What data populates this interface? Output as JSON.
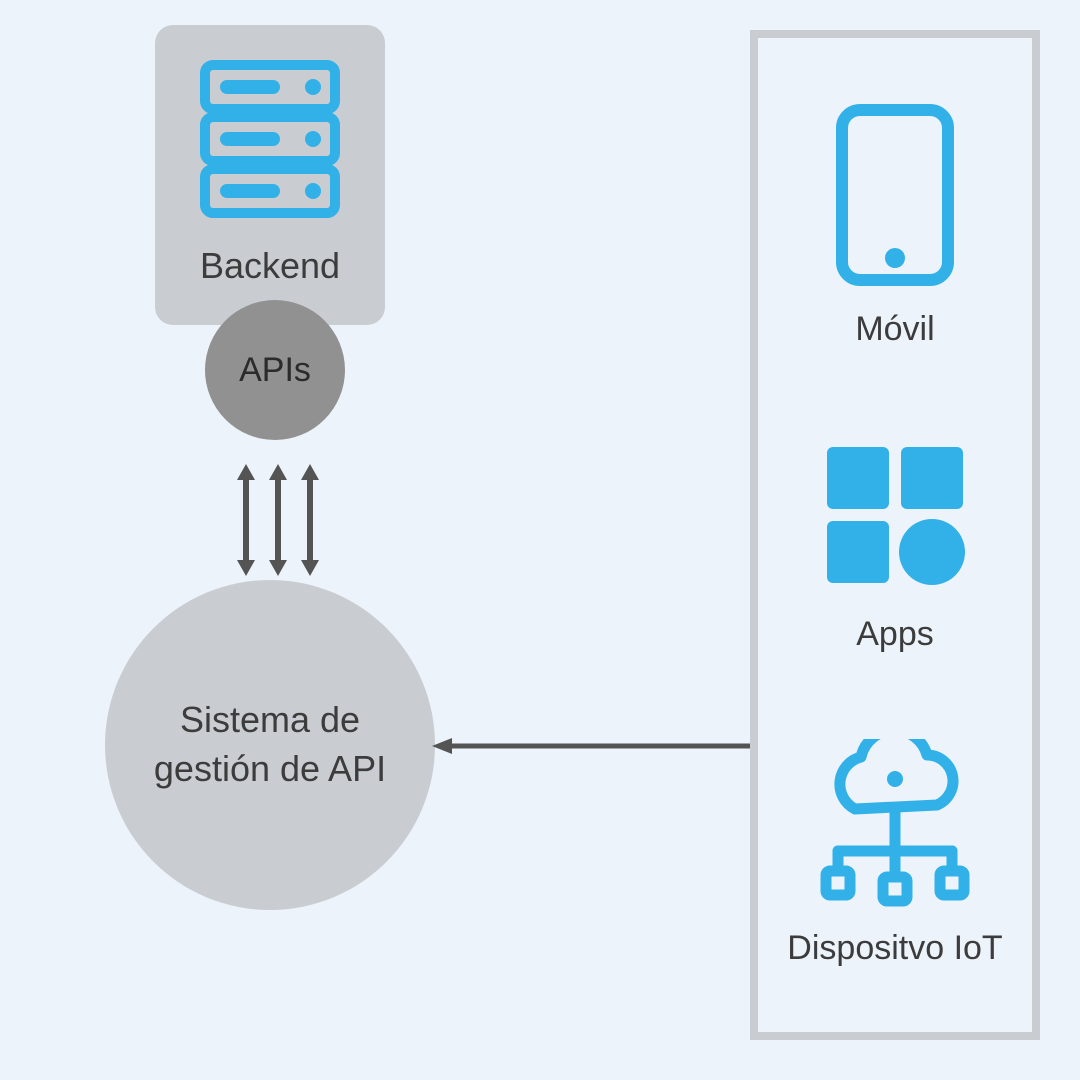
{
  "backend": {
    "label": "Backend"
  },
  "apis": {
    "label": "APIs"
  },
  "management": {
    "label": "Sistema de gestión de API"
  },
  "clients": {
    "mobile": {
      "label": "Móvil"
    },
    "apps": {
      "label": "Apps"
    },
    "iot": {
      "label": "Dispositvo IoT"
    }
  },
  "colors": {
    "accent": "#32b1e8",
    "panel": "#c9cdd2",
    "darkgrey": "#545454",
    "text": "#3c3c3c"
  }
}
